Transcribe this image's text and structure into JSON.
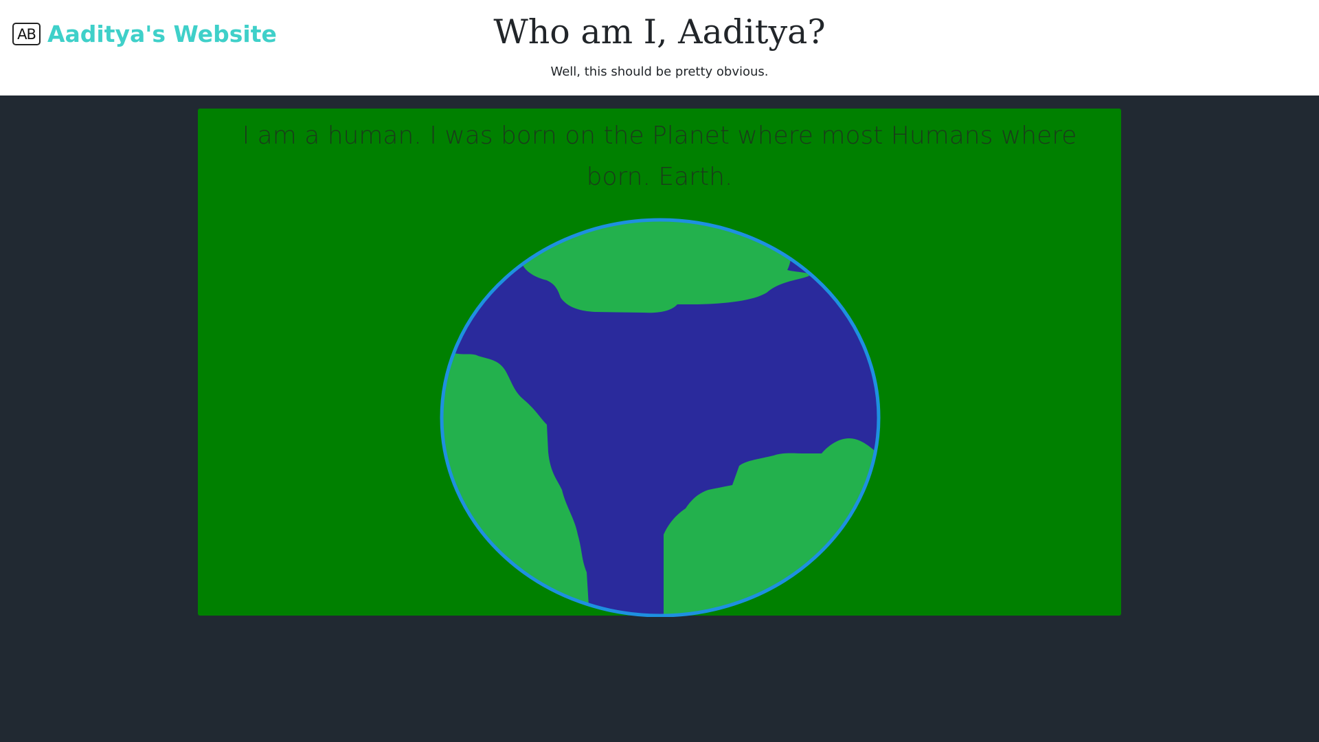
{
  "header": {
    "logo_text": "AB",
    "brand_name": "Aaditya's Website",
    "title": "Who am I, Aaditya?",
    "subtitle": "Well, this should be pretty obvious."
  },
  "main": {
    "intro_text": "I am a human. I was born on the Planet where most Humans where born. Earth."
  },
  "colors": {
    "header_bg": "#ffffff",
    "page_bg": "#212932",
    "brand_accent": "#3fd0c9",
    "card_bg": "#008000",
    "ocean": "#2a2a9c",
    "land": "#23b14d",
    "outline": "#1e90e0"
  }
}
